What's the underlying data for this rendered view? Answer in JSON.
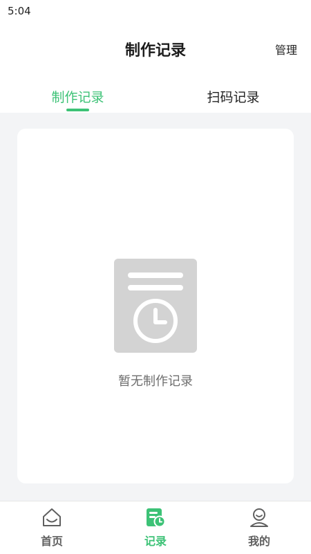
{
  "status_bar": {
    "time": "5:04"
  },
  "header": {
    "title": "制作记录",
    "manage_label": "管理"
  },
  "tabs": [
    {
      "label": "制作记录",
      "active": true
    },
    {
      "label": "扫码记录",
      "active": false
    }
  ],
  "empty_state": {
    "icon": "document-clock-icon",
    "message": "暂无制作记录"
  },
  "bottom_nav": [
    {
      "label": "首页",
      "icon": "home-icon",
      "active": false
    },
    {
      "label": "记录",
      "icon": "record-clock-icon",
      "active": true
    },
    {
      "label": "我的",
      "icon": "user-icon",
      "active": false
    }
  ],
  "colors": {
    "accent": "#3cc276",
    "background": "#f3f4f6",
    "placeholder_gray": "#d3d3d3"
  }
}
